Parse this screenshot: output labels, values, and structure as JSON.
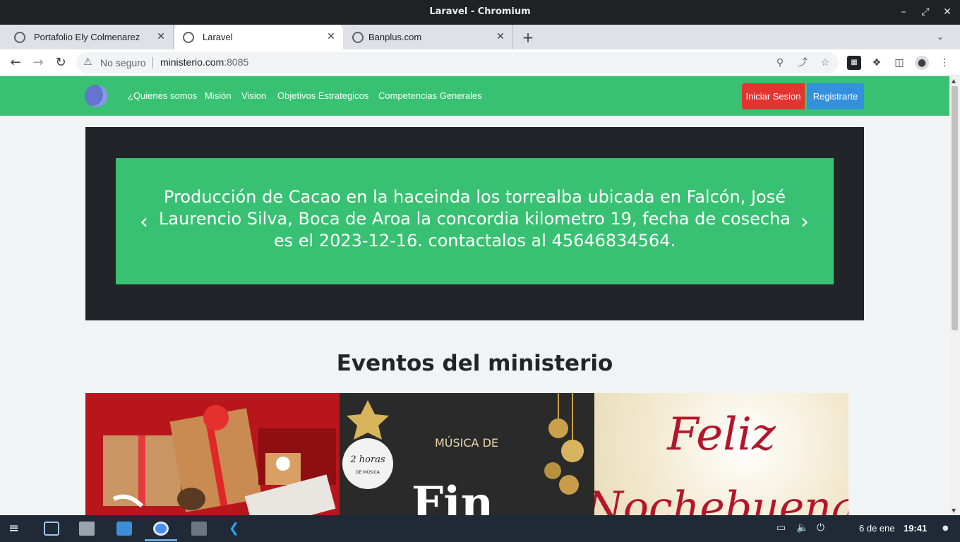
{
  "window": {
    "title": "Laravel - Chromium"
  },
  "tabs": [
    {
      "label": "Portafolio Ely Colmenarez",
      "active": false
    },
    {
      "label": "Laravel",
      "active": true
    },
    {
      "label": "Banplus.com",
      "active": false
    }
  ],
  "omnibox": {
    "security_label": "No seguro",
    "host": "ministerio.com",
    "port": ":8085"
  },
  "site": {
    "nav": [
      "¿Quienes somos",
      "Misión",
      "Vision",
      "Objetivos Estrategicos",
      "Competencias Generales"
    ],
    "login_label": "Iniciar Sesion",
    "register_label": "Registrarte",
    "carousel_text": "Producción de Cacao en la haceinda los torrealba ubicada en Falcón, José Laurencio Silva, Boca de Aroa la concordia kilometro 19, fecha de cosecha es el 2023-12-16. contactalos al 45646834564.",
    "events_title": "Eventos del ministerio",
    "event_cards": [
      {
        "name": "gifts-image"
      },
      {
        "name": "musica-de-fin-image",
        "text_top": "MÚSICA DE",
        "text_badge": "2 horas",
        "text_badge_sub": "DE MÚSICA",
        "text_big": "Fin"
      },
      {
        "name": "feliz-nochebuena-image",
        "text_line1": "Feliz",
        "text_line2": "Nochebuena"
      }
    ]
  },
  "taskbar": {
    "date": "6 de ene",
    "time": "19:41"
  },
  "colors": {
    "brand_green": "#38c172",
    "danger": "#e3342f",
    "primary": "#3490dc",
    "dark": "#212529"
  }
}
